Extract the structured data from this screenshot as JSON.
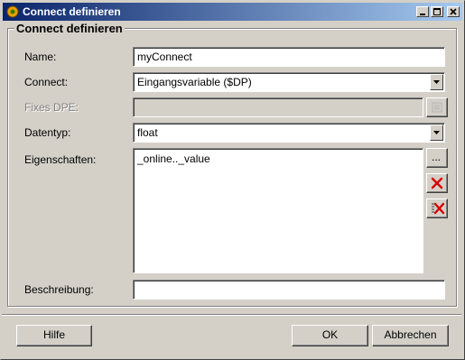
{
  "window": {
    "title": "Connect definieren"
  },
  "group": {
    "title": "Connect definieren"
  },
  "form": {
    "name_label": "Name:",
    "name_value": "myConnect",
    "connect_label": "Connect:",
    "connect_value": "Eingangsvariable ($DP)",
    "fixes_dpe_label": "Fixes DPE:",
    "fixes_dpe_value": "",
    "datentyp_label": "Datentyp:",
    "datentyp_value": "float",
    "eigenschaften_label": "Eigenschaften:",
    "eigenschaften_items": [
      "_online.._value"
    ],
    "beschreibung_label": "Beschreibung:",
    "beschreibung_value": "",
    "browse_button_label": "..."
  },
  "buttons": {
    "hilfe": "Hilfe",
    "ok": "OK",
    "abbrechen": "Abbrechen"
  },
  "icons": {
    "app": "settings-gear-icon",
    "minimize": "minimize-icon",
    "maximize": "maximize-icon",
    "close": "close-icon",
    "fixes_dpe_picker": "datapoint-picker-icon",
    "delete_one": "red-x-icon",
    "delete_all": "red-x-list-icon"
  },
  "colors": {
    "title_start": "#0a246a",
    "title_end": "#a6caf0",
    "delete_red": "#d40000"
  }
}
